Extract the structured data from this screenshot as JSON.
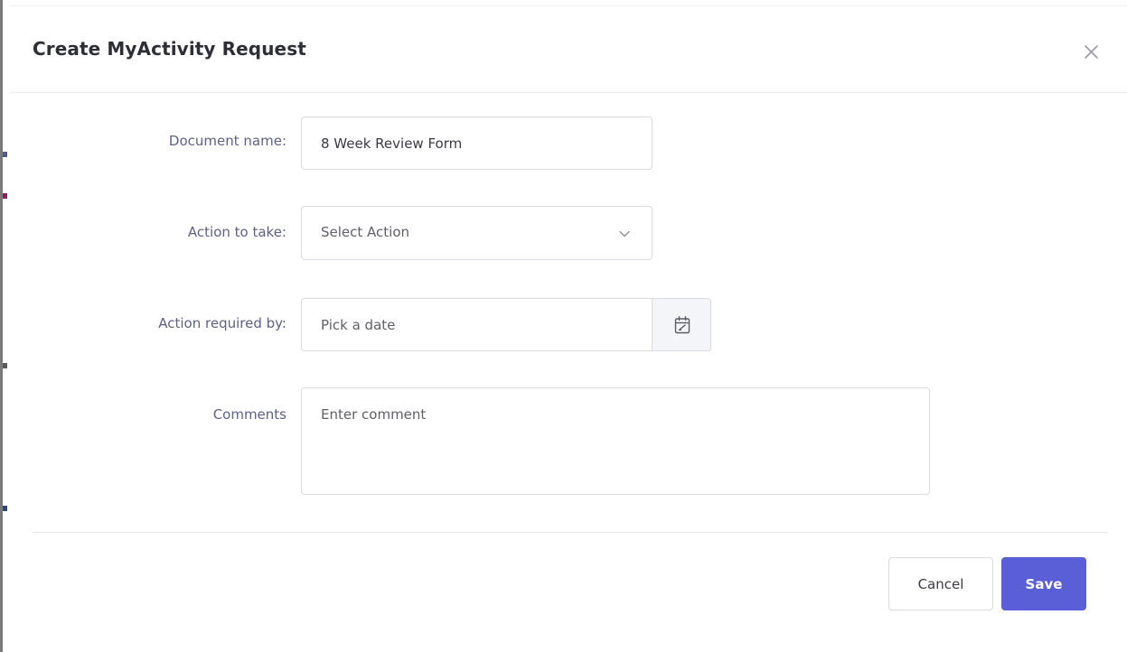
{
  "modal": {
    "title": "Create MyActivity Request"
  },
  "form": {
    "document_name": {
      "label": "Document name:",
      "value": "8 Week Review Form"
    },
    "action_to_take": {
      "label": "Action to take:",
      "selected": "Select Action"
    },
    "action_required_by": {
      "label": "Action required by:",
      "placeholder": "Pick a date"
    },
    "comments": {
      "label": "Comments",
      "placeholder": "Enter comment"
    }
  },
  "footer": {
    "cancel_label": "Cancel",
    "save_label": "Save"
  },
  "colors": {
    "primary": "#5a5fd8",
    "label": "#5d6088",
    "border": "#d9dbe3"
  },
  "icons": {
    "close": "close-icon",
    "chevron": "chevron-down-icon",
    "calendar": "calendar-icon"
  }
}
